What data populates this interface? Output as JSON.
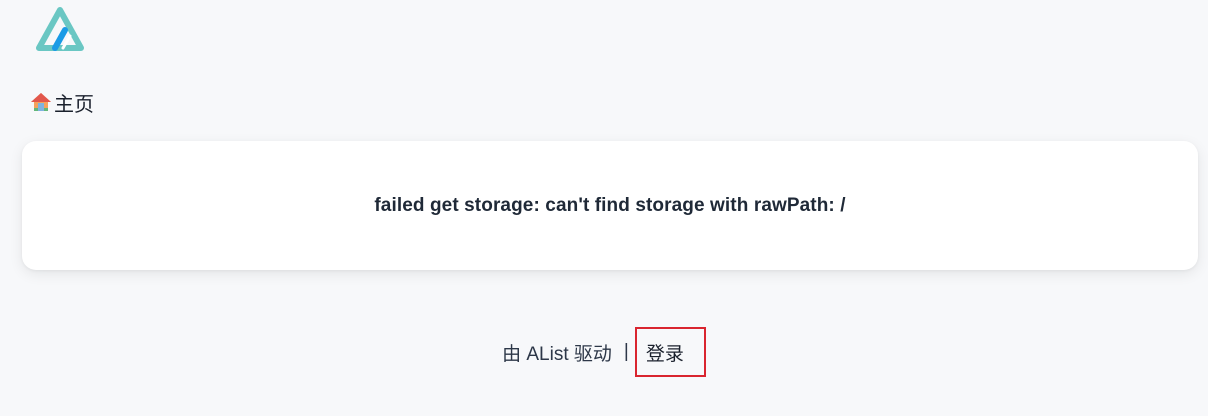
{
  "header": {
    "logo_icon": "alist-logo-icon"
  },
  "breadcrumb": {
    "home_icon": "house-icon",
    "home_label": "主页"
  },
  "main": {
    "error_message": "failed get storage: can't find storage with rawPath: /"
  },
  "footer": {
    "powered_by": "由 AList 驱动",
    "separator": "|",
    "login_label": "登录"
  },
  "colors": {
    "background": "#f7f8fa",
    "logo_teal": "#6ac7c3",
    "logo_blue": "#1a9be6",
    "highlight_border": "#d9252f"
  }
}
